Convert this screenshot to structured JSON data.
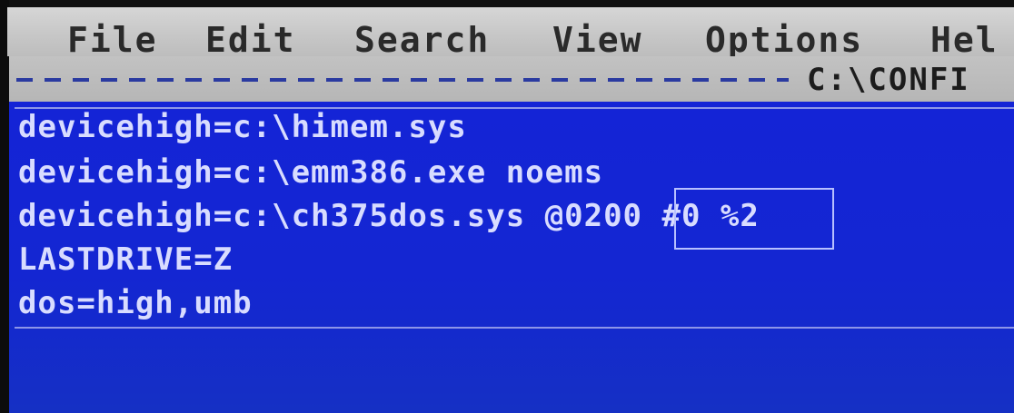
{
  "menu": {
    "items": [
      "File",
      "Edit",
      "Search",
      "View",
      "Options",
      "Hel"
    ]
  },
  "title": {
    "file_name": "C:\\CONFI"
  },
  "editor": {
    "lines": [
      "devicehigh=c:\\himem.sys",
      "devicehigh=c:\\emm386.exe noems",
      "devicehigh=c:\\ch375dos.sys @0200 #0 %2",
      "LASTDRIVE=Z",
      "dos=high,umb"
    ]
  },
  "colors": {
    "menu_bg": "#c8c8c8",
    "editor_bg": "#1424d6",
    "editor_text": "#d8dcff"
  }
}
